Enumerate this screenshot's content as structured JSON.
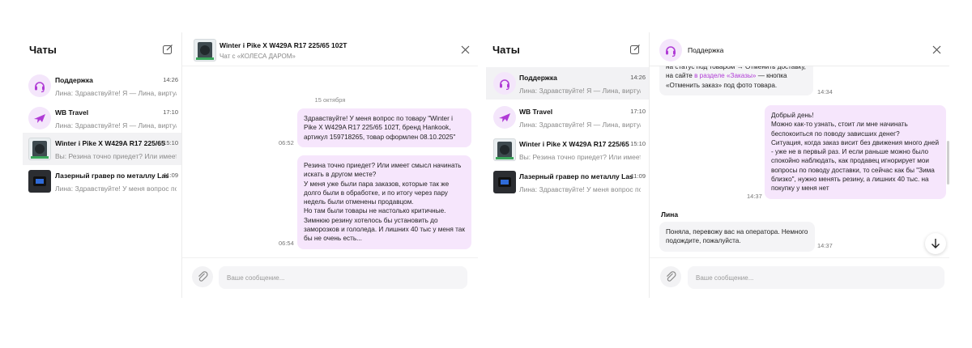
{
  "colors": {
    "accent": "#b03bd6",
    "out_bubble": "#f6e6fc",
    "in_bubble": "#f4f4f6"
  },
  "left": {
    "list_title": "Чаты",
    "chats": [
      {
        "name": "Поддержка",
        "time": "14:26",
        "preview": "Лина: Здравствуйте! Я — Лина, виртуальный",
        "icon": "support-headset-icon"
      },
      {
        "name": "WB Travel",
        "time": "17:10",
        "preview": "Лина: Здравствуйте! Я — Лина, виртуальный",
        "icon": "airplane-icon"
      },
      {
        "name": "Winter i Pike X W429A R17 225/65",
        "time": "15:10",
        "preview": "Вы: Резина точно приедет? Или имеет смысл",
        "icon": "tire-product-thumbnail"
      },
      {
        "name": "Лазерный гравер по металлу Laser",
        "time": "11:09",
        "preview": "Лина: Здравствуйте! У меня вопрос по тов",
        "icon": "engraver-product-thumbnail"
      }
    ],
    "chat": {
      "title": "Winter i Pike X W429A R17 225/65 102T",
      "subtitle": "Чат с «КОЛЕСА ДАРОМ»",
      "date": "15 октября",
      "messages": [
        {
          "time": "06:52",
          "text": "Здравствуйте! У меня вопрос по товару \"Winter i Pike X W429A R17 225/65 102T, бренд Hankook, артикул 159718265, товар оформлен 08.10.2025\""
        },
        {
          "time": "06:54",
          "text": "Резина точно приедет? Или имеет смысл начинать искать в другом месте?\nУ меня уже были пара заказов, которые так же долго были в обработке, и по итогу через пару недель были отменены продавцом.\nНо там были товары не настолько критичные.\nЗимнюю резину хотелось бы установить до заморозков и гололеда. И лишних 40 тыс у меня так бы не очень есть..."
        }
      ],
      "input_placeholder": "Ваше сообщение..."
    }
  },
  "right": {
    "list_title": "Чаты",
    "chats": [
      {
        "name": "Поддержка",
        "time": "14:26",
        "preview": "Лина: Здравствуйте! Я — Лина, виртуальный",
        "icon": "support-headset-icon"
      },
      {
        "name": "WB Travel",
        "time": "17:10",
        "preview": "Лина: Здравствуйте! Я — Лина, виртуальный",
        "icon": "airplane-icon"
      },
      {
        "name": "Winter i Pike X W429A R17 225/65",
        "time": "15:10",
        "preview": "Вы: Резина точно приедет? Или имеет смысл",
        "icon": "tire-product-thumbnail"
      },
      {
        "name": "Лазерный гравер по металлу Laser",
        "time": "11:09",
        "preview": "Лина: Здравствуйте! У меня вопрос по тов",
        "icon": "engraver-product-thumbnail"
      }
    ],
    "chat": {
      "title": "Поддержка",
      "top_message": {
        "text_before": "на статус под товаром → Отменить доставку,\nна сайте ",
        "link": "в разделе «Заказы»",
        "text_after": " — кнопка\n«Отменить заказ» под фото товара.",
        "time": "14:34"
      },
      "user_message": {
        "text": "Добрый день!\nМожно как-то узнать, стоит ли мне начинать беспокоиться по поводу зависших денег?\nСитуация, когда заказ висит без движения много дней - уже не в первый раз. И если раньше можно было спокойно наблюдать, как продавец игнорирует мои вопросы по поводу доставки, то сейчас как бы \"Зима близко\", нужно менять резину, а лишних 40 тыс. на покупку у меня нет",
        "time": "14:37"
      },
      "agent_name": "Лина",
      "agent_message": {
        "text": "Поняла, перевожу вас на оператора. Немного подождите, пожалуйста.",
        "time": "14:37"
      },
      "input_placeholder": "Ваше сообщение..."
    }
  }
}
